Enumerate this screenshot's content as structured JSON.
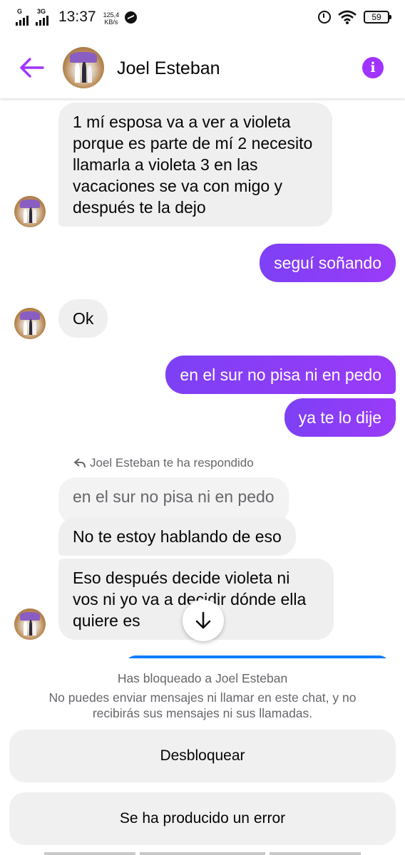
{
  "status_bar": {
    "network_1": "G",
    "network_2": "3G",
    "time": "13:37",
    "speed_value": "125,4",
    "speed_unit": "KB/s",
    "battery": "59"
  },
  "header": {
    "contact_name": "Joel Esteban",
    "back_icon": "arrow-left-icon",
    "info_icon": "info-icon",
    "accent_color": "#a033ff"
  },
  "messages": [
    {
      "from": "them",
      "text": "1 mí esposa va a ver a violeta porque es parte de mí 2 necesito llamarla a violeta 3 en las vacaciones se va con migo y después te la dejo"
    },
    {
      "from": "me",
      "text": "seguí soñando"
    },
    {
      "from": "them",
      "text": "Ok"
    },
    {
      "from": "me",
      "text": "en el sur no pisa ni en pedo"
    },
    {
      "from": "me",
      "text": "ya te lo dije"
    },
    {
      "from": "them",
      "text": "No te estoy hablando de eso",
      "reply_note": "Joel Esteban te ha respondido",
      "quoted": "en el sur no pisa ni en pedo"
    },
    {
      "from": "them",
      "text": "Eso después decide violeta ni vos ni yo va a decidir dónde ella quiere es"
    }
  ],
  "blocked": {
    "title": "Has bloqueado a Joel Esteban",
    "description": "No puedes enviar mensajes ni llamar en este chat, y no recibirás sus mensajes ni sus llamadas.",
    "unblock_label": "Desbloquear",
    "error_label": "Se ha producido un error"
  },
  "colors": {
    "outgoing_bubble": "#8a3ff7",
    "incoming_bubble": "#efefef",
    "muted_text": "#65676b"
  }
}
